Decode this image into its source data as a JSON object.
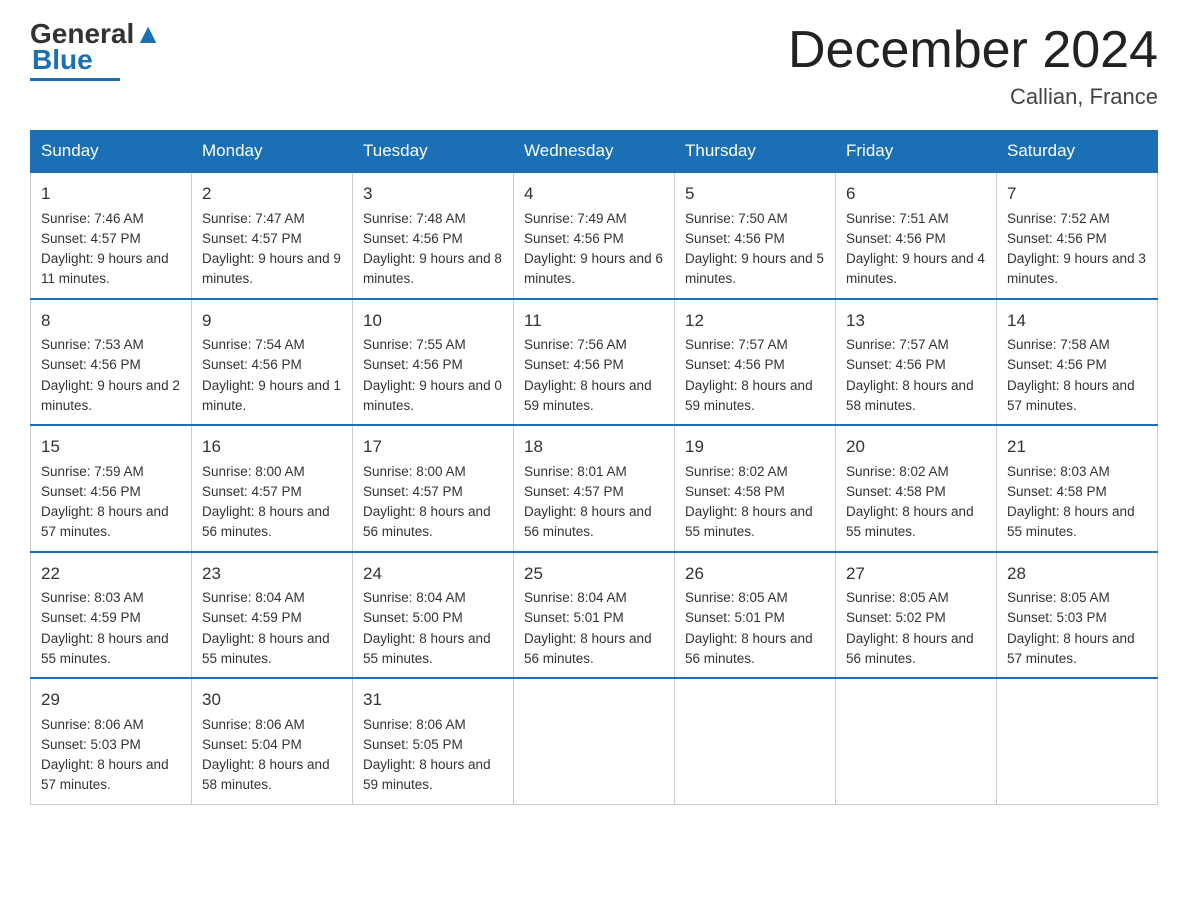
{
  "header": {
    "logo_text1": "General",
    "logo_text2": "Blue",
    "month_title": "December 2024",
    "location": "Callian, France"
  },
  "days_of_week": [
    "Sunday",
    "Monday",
    "Tuesday",
    "Wednesday",
    "Thursday",
    "Friday",
    "Saturday"
  ],
  "weeks": [
    [
      {
        "num": "1",
        "sunrise": "7:46 AM",
        "sunset": "4:57 PM",
        "daylight": "9 hours and 11 minutes."
      },
      {
        "num": "2",
        "sunrise": "7:47 AM",
        "sunset": "4:57 PM",
        "daylight": "9 hours and 9 minutes."
      },
      {
        "num": "3",
        "sunrise": "7:48 AM",
        "sunset": "4:56 PM",
        "daylight": "9 hours and 8 minutes."
      },
      {
        "num": "4",
        "sunrise": "7:49 AM",
        "sunset": "4:56 PM",
        "daylight": "9 hours and 6 minutes."
      },
      {
        "num": "5",
        "sunrise": "7:50 AM",
        "sunset": "4:56 PM",
        "daylight": "9 hours and 5 minutes."
      },
      {
        "num": "6",
        "sunrise": "7:51 AM",
        "sunset": "4:56 PM",
        "daylight": "9 hours and 4 minutes."
      },
      {
        "num": "7",
        "sunrise": "7:52 AM",
        "sunset": "4:56 PM",
        "daylight": "9 hours and 3 minutes."
      }
    ],
    [
      {
        "num": "8",
        "sunrise": "7:53 AM",
        "sunset": "4:56 PM",
        "daylight": "9 hours and 2 minutes."
      },
      {
        "num": "9",
        "sunrise": "7:54 AM",
        "sunset": "4:56 PM",
        "daylight": "9 hours and 1 minute."
      },
      {
        "num": "10",
        "sunrise": "7:55 AM",
        "sunset": "4:56 PM",
        "daylight": "9 hours and 0 minutes."
      },
      {
        "num": "11",
        "sunrise": "7:56 AM",
        "sunset": "4:56 PM",
        "daylight": "8 hours and 59 minutes."
      },
      {
        "num": "12",
        "sunrise": "7:57 AM",
        "sunset": "4:56 PM",
        "daylight": "8 hours and 59 minutes."
      },
      {
        "num": "13",
        "sunrise": "7:57 AM",
        "sunset": "4:56 PM",
        "daylight": "8 hours and 58 minutes."
      },
      {
        "num": "14",
        "sunrise": "7:58 AM",
        "sunset": "4:56 PM",
        "daylight": "8 hours and 57 minutes."
      }
    ],
    [
      {
        "num": "15",
        "sunrise": "7:59 AM",
        "sunset": "4:56 PM",
        "daylight": "8 hours and 57 minutes."
      },
      {
        "num": "16",
        "sunrise": "8:00 AM",
        "sunset": "4:57 PM",
        "daylight": "8 hours and 56 minutes."
      },
      {
        "num": "17",
        "sunrise": "8:00 AM",
        "sunset": "4:57 PM",
        "daylight": "8 hours and 56 minutes."
      },
      {
        "num": "18",
        "sunrise": "8:01 AM",
        "sunset": "4:57 PM",
        "daylight": "8 hours and 56 minutes."
      },
      {
        "num": "19",
        "sunrise": "8:02 AM",
        "sunset": "4:58 PM",
        "daylight": "8 hours and 55 minutes."
      },
      {
        "num": "20",
        "sunrise": "8:02 AM",
        "sunset": "4:58 PM",
        "daylight": "8 hours and 55 minutes."
      },
      {
        "num": "21",
        "sunrise": "8:03 AM",
        "sunset": "4:58 PM",
        "daylight": "8 hours and 55 minutes."
      }
    ],
    [
      {
        "num": "22",
        "sunrise": "8:03 AM",
        "sunset": "4:59 PM",
        "daylight": "8 hours and 55 minutes."
      },
      {
        "num": "23",
        "sunrise": "8:04 AM",
        "sunset": "4:59 PM",
        "daylight": "8 hours and 55 minutes."
      },
      {
        "num": "24",
        "sunrise": "8:04 AM",
        "sunset": "5:00 PM",
        "daylight": "8 hours and 55 minutes."
      },
      {
        "num": "25",
        "sunrise": "8:04 AM",
        "sunset": "5:01 PM",
        "daylight": "8 hours and 56 minutes."
      },
      {
        "num": "26",
        "sunrise": "8:05 AM",
        "sunset": "5:01 PM",
        "daylight": "8 hours and 56 minutes."
      },
      {
        "num": "27",
        "sunrise": "8:05 AM",
        "sunset": "5:02 PM",
        "daylight": "8 hours and 56 minutes."
      },
      {
        "num": "28",
        "sunrise": "8:05 AM",
        "sunset": "5:03 PM",
        "daylight": "8 hours and 57 minutes."
      }
    ],
    [
      {
        "num": "29",
        "sunrise": "8:06 AM",
        "sunset": "5:03 PM",
        "daylight": "8 hours and 57 minutes."
      },
      {
        "num": "30",
        "sunrise": "8:06 AM",
        "sunset": "5:04 PM",
        "daylight": "8 hours and 58 minutes."
      },
      {
        "num": "31",
        "sunrise": "8:06 AM",
        "sunset": "5:05 PM",
        "daylight": "8 hours and 59 minutes."
      },
      null,
      null,
      null,
      null
    ]
  ],
  "labels": {
    "sunrise": "Sunrise:",
    "sunset": "Sunset:",
    "daylight": "Daylight:"
  }
}
